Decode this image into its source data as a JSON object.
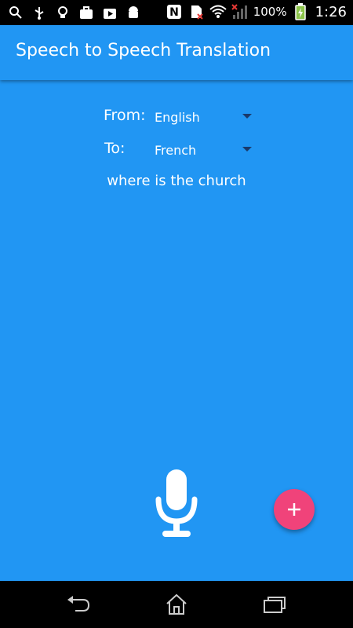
{
  "status_bar": {
    "left_icons": [
      "search-icon",
      "usb-icon",
      "lightbulb-icon",
      "briefcase-icon",
      "media-icon",
      "android-icon"
    ],
    "right_icons": [
      "nfc-icon",
      "sim-icon",
      "wifi-icon",
      "signal-icon",
      "battery-icon"
    ],
    "battery": "100%",
    "time": "1:26"
  },
  "app_bar": {
    "title": "Speech to Speech Translation"
  },
  "form": {
    "from_label": "From:",
    "from_value": "English",
    "to_label": "To:",
    "to_value": "French"
  },
  "recognized_text": "where is the church",
  "icons": {
    "mic": "microphone-icon",
    "fab": "plus-icon",
    "nav_back": "back-icon",
    "nav_home": "home-icon",
    "nav_recents": "recents-icon"
  },
  "colors": {
    "primary": "#2196F3",
    "accent": "#F0437A",
    "spinner_arrow": "#1a3a6b"
  }
}
